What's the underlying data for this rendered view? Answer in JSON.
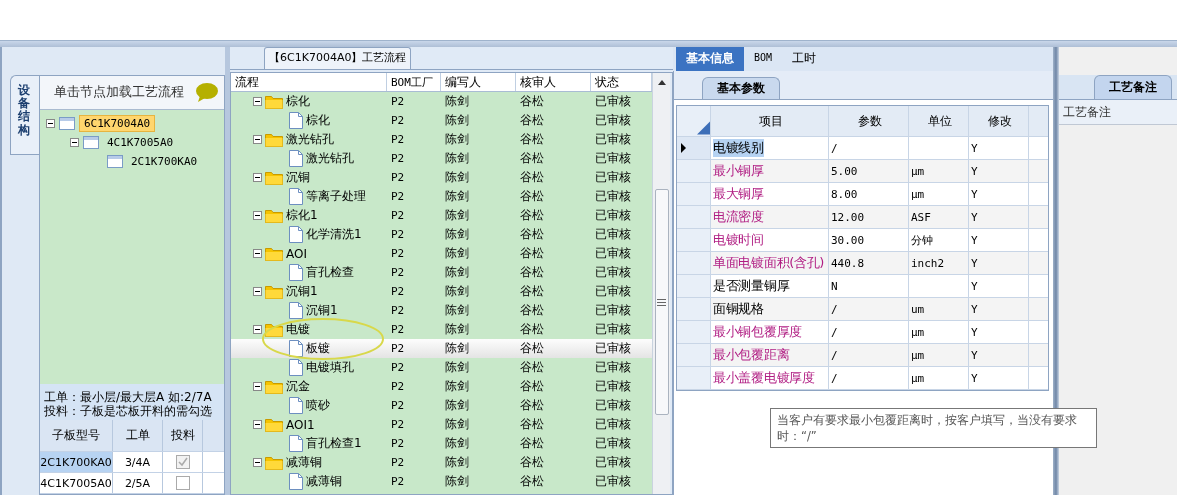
{
  "left_panel": {
    "vertical_tab": "设备结构",
    "header": "单击节点加载工艺流程",
    "tree": [
      {
        "label": "6C1K7004A0",
        "selected": true,
        "expanded": true,
        "children": [
          {
            "label": "4C1K7005A0",
            "selected": false,
            "expanded": true,
            "children": [
              {
                "label": "2C1K700KA0",
                "selected": false
              }
            ]
          }
        ]
      }
    ],
    "notes": [
      "工单：最小层/最大层A 如:2/7A",
      "投料：子板是芯板开料的需勾选"
    ],
    "table": {
      "columns": [
        "子板型号",
        "工单",
        "投料"
      ],
      "rows": [
        {
          "cells": [
            "2C1K700KA0",
            "3/4A"
          ],
          "checked": true,
          "selected": true
        },
        {
          "cells": [
            "4C1K7005A0",
            "2/5A"
          ],
          "checked": false,
          "selected": false
        }
      ]
    }
  },
  "flow": {
    "title": "【6C1K7004A0】工艺流程",
    "tree_column": "流程",
    "columns": [
      "BOM工厂",
      "编写人",
      "核审人",
      "状态"
    ],
    "rows": [
      {
        "name": "棕化",
        "kind": "folder",
        "expanded": true,
        "cells": [
          "P2",
          "陈剑",
          "谷松",
          "已审核"
        ],
        "children": [
          {
            "name": "棕化",
            "kind": "doc",
            "selected": false,
            "cells": [
              "P2",
              "陈剑",
              "谷松",
              "已审核"
            ]
          }
        ]
      },
      {
        "name": "激光钻孔",
        "kind": "folder",
        "expanded": true,
        "cells": [
          "P2",
          "陈剑",
          "谷松",
          "已审核"
        ],
        "children": [
          {
            "name": "激光钻孔",
            "kind": "doc",
            "selected": false,
            "cells": [
              "P2",
              "陈剑",
              "谷松",
              "已审核"
            ]
          }
        ]
      },
      {
        "name": "沉铜",
        "kind": "folder",
        "expanded": true,
        "cells": [
          "P2",
          "陈剑",
          "谷松",
          "已审核"
        ],
        "children": [
          {
            "name": "等离子处理",
            "kind": "doc",
            "selected": false,
            "cells": [
              "P2",
              "陈剑",
              "谷松",
              "已审核"
            ]
          }
        ]
      },
      {
        "name": "棕化1",
        "kind": "folder",
        "expanded": true,
        "cells": [
          "P2",
          "陈剑",
          "谷松",
          "已审核"
        ],
        "children": [
          {
            "name": "化学清洗1",
            "kind": "doc",
            "selected": false,
            "cells": [
              "P2",
              "陈剑",
              "谷松",
              "已审核"
            ]
          }
        ]
      },
      {
        "name": "AOI",
        "kind": "folder",
        "expanded": true,
        "cells": [
          "P2",
          "陈剑",
          "谷松",
          "已审核"
        ],
        "children": [
          {
            "name": "盲孔检查",
            "kind": "doc",
            "selected": false,
            "cells": [
              "P2",
              "陈剑",
              "谷松",
              "已审核"
            ]
          }
        ]
      },
      {
        "name": "沉铜1",
        "kind": "folder",
        "expanded": true,
        "cells": [
          "P2",
          "陈剑",
          "谷松",
          "已审核"
        ],
        "children": [
          {
            "name": "沉铜1",
            "kind": "doc",
            "selected": false,
            "cells": [
              "P2",
              "陈剑",
              "谷松",
              "已审核"
            ]
          }
        ]
      },
      {
        "name": "电镀",
        "kind": "folder",
        "expanded": true,
        "cells": [
          "P2",
          "陈剑",
          "谷松",
          "已审核"
        ],
        "children": [
          {
            "name": "板镀",
            "kind": "doc",
            "selected": true,
            "cells": [
              "P2",
              "陈剑",
              "谷松",
              "已审核"
            ]
          },
          {
            "name": "电镀填孔",
            "kind": "doc",
            "selected": false,
            "cells": [
              "P2",
              "陈剑",
              "谷松",
              "已审核"
            ]
          }
        ]
      },
      {
        "name": "沉金",
        "kind": "folder",
        "expanded": true,
        "cells": [
          "P2",
          "陈剑",
          "谷松",
          "已审核"
        ],
        "children": [
          {
            "name": "喷砂",
            "kind": "doc",
            "selected": false,
            "cells": [
              "P2",
              "陈剑",
              "谷松",
              "已审核"
            ]
          }
        ]
      },
      {
        "name": "AOI1",
        "kind": "folder",
        "expanded": true,
        "cells": [
          "P2",
          "陈剑",
          "谷松",
          "已审核"
        ],
        "children": [
          {
            "name": "盲孔检查1",
            "kind": "doc",
            "selected": false,
            "cells": [
              "P2",
              "陈剑",
              "谷松",
              "已审核"
            ]
          }
        ]
      },
      {
        "name": "减薄铜",
        "kind": "folder",
        "expanded": true,
        "cells": [
          "P2",
          "陈剑",
          "谷松",
          "已审核"
        ],
        "children": [
          {
            "name": "减薄铜",
            "kind": "doc",
            "selected": false,
            "cells": [
              "P2",
              "陈剑",
              "谷松",
              "已审核"
            ]
          }
        ]
      }
    ]
  },
  "info": {
    "tabs": [
      {
        "label": "基本信息",
        "selected": true
      },
      {
        "label": "BOM",
        "selected": false
      },
      {
        "label": "工时",
        "selected": false
      }
    ],
    "subtab": "基本参数",
    "columns": [
      "项目",
      "参数",
      "单位",
      "修改"
    ],
    "rows": [
      {
        "item": "电镀线别",
        "value": "/",
        "unit": "",
        "modify": "Y",
        "kind": "plain",
        "selected": true
      },
      {
        "item": "最小铜厚",
        "value": "5.00",
        "unit": "μm",
        "modify": "Y",
        "kind": "highlighted",
        "selected": false
      },
      {
        "item": "最大铜厚",
        "value": "8.00",
        "unit": "μm",
        "modify": "Y",
        "kind": "highlighted",
        "selected": false
      },
      {
        "item": "电流密度",
        "value": "12.00",
        "unit": "ASF",
        "modify": "Y",
        "kind": "highlighted",
        "selected": false
      },
      {
        "item": "电镀时间",
        "value": "30.00",
        "unit": "分钟",
        "modify": "Y",
        "kind": "highlighted",
        "selected": false
      },
      {
        "item": "单面电镀面积(含孔)",
        "value": "440.8",
        "unit": "inch2",
        "modify": "Y",
        "kind": "highlighted",
        "selected": false
      },
      {
        "item": "是否测量铜厚",
        "value": "N",
        "unit": "",
        "modify": "Y",
        "kind": "plain",
        "selected": false
      },
      {
        "item": "面铜规格",
        "value": "/",
        "unit": "um",
        "modify": "Y",
        "kind": "plain",
        "selected": false
      },
      {
        "item": "最小铜包覆厚度",
        "value": "/",
        "unit": "μm",
        "modify": "Y",
        "kind": "highlighted",
        "selected": false
      },
      {
        "item": "最小包覆距离",
        "value": "/",
        "unit": "μm",
        "modify": "Y",
        "kind": "highlighted",
        "selected": false
      },
      {
        "item": "最小盖覆电镀厚度",
        "value": "/",
        "unit": "μm",
        "modify": "Y",
        "kind": "highlighted",
        "selected": false
      }
    ],
    "tooltip": "当客户有要求最小包覆距离时，按客户填写，当没有要求时：“/”"
  },
  "notes_panel": {
    "tab": "工艺备注",
    "label": "工艺备注"
  }
}
